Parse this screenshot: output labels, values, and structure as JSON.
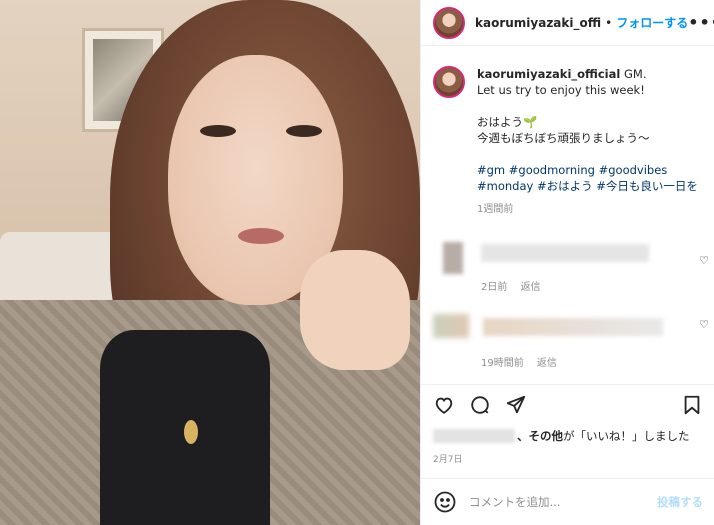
{
  "header": {
    "username": "kaorumiyazaki_offi",
    "separator": "•",
    "follow_label": "フォローする",
    "more_label": "•••"
  },
  "caption": {
    "username": "kaorumiyazaki_official",
    "first_line": "GM.",
    "line2": "Let us try to enjoy this week!",
    "line3": "おはよう🌱",
    "line4": "今週もぼちぼち頑張りましょう〜",
    "tags1": "#gm #goodmorning #goodvibes",
    "tags2": "#monday #おはよう #今日も良い一日を",
    "time": "1週間前"
  },
  "comments": [
    {
      "time": "2日前",
      "reply": "返信"
    },
    {
      "time": "19時間前",
      "reply": "返信"
    }
  ],
  "actions": {
    "like_icon": "heart-icon",
    "comment_icon": "comment-icon",
    "share_icon": "share-icon",
    "save_icon": "bookmark-icon"
  },
  "likes": {
    "others": "、その他",
    "suffix": "が「いいね！」しました"
  },
  "post_date": "2月7日",
  "comment_bar": {
    "placeholder": "コメントを追加...",
    "post_label": "投稿する"
  },
  "colors": {
    "accent": "#0095f6",
    "post_disabled": "#b2dffc",
    "muted": "#8e8e8e",
    "hashtag": "#00376b"
  }
}
